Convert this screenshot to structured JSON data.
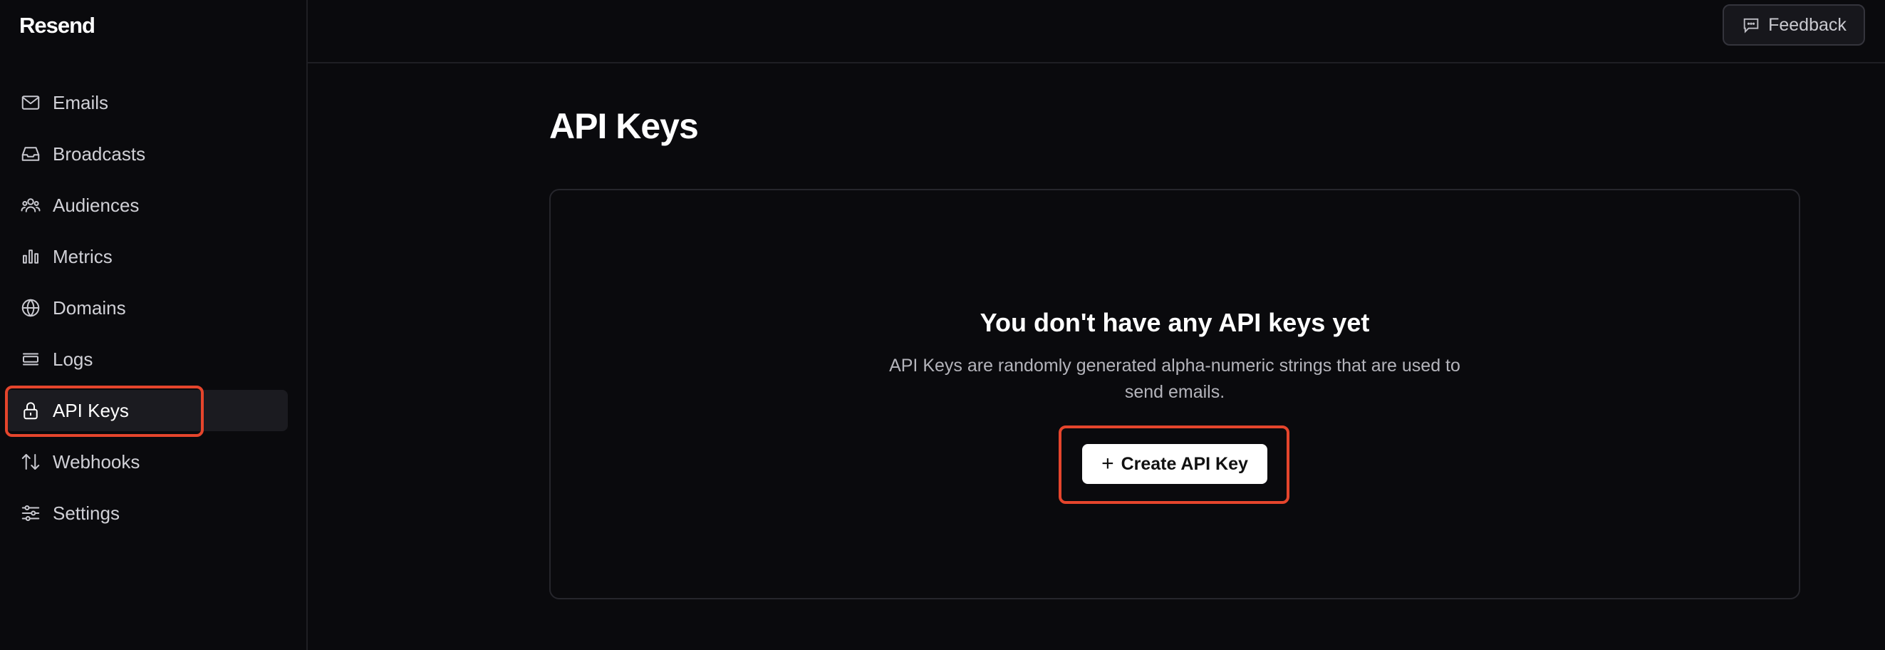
{
  "app": {
    "logo": "Resend"
  },
  "sidebar": {
    "items": [
      {
        "label": "Emails",
        "icon": "mail-icon"
      },
      {
        "label": "Broadcasts",
        "icon": "inbox-icon"
      },
      {
        "label": "Audiences",
        "icon": "users-icon"
      },
      {
        "label": "Metrics",
        "icon": "bar-chart-icon"
      },
      {
        "label": "Domains",
        "icon": "globe-icon"
      },
      {
        "label": "Logs",
        "icon": "logs-icon"
      },
      {
        "label": "API Keys",
        "icon": "lock-icon",
        "active": true
      },
      {
        "label": "Webhooks",
        "icon": "arrows-updown-icon"
      },
      {
        "label": "Settings",
        "icon": "sliders-icon"
      }
    ]
  },
  "header": {
    "feedback_label": "Feedback"
  },
  "main": {
    "title": "API Keys",
    "empty_state": {
      "title": "You don't have any API keys yet",
      "description": "API Keys are randomly generated alpha-numeric strings that are used to send emails.",
      "button_label": "Create API Key"
    }
  },
  "colors": {
    "background": "#0a0a0d",
    "highlight": "#e5452c",
    "active_item_bg": "#1b1b20"
  }
}
